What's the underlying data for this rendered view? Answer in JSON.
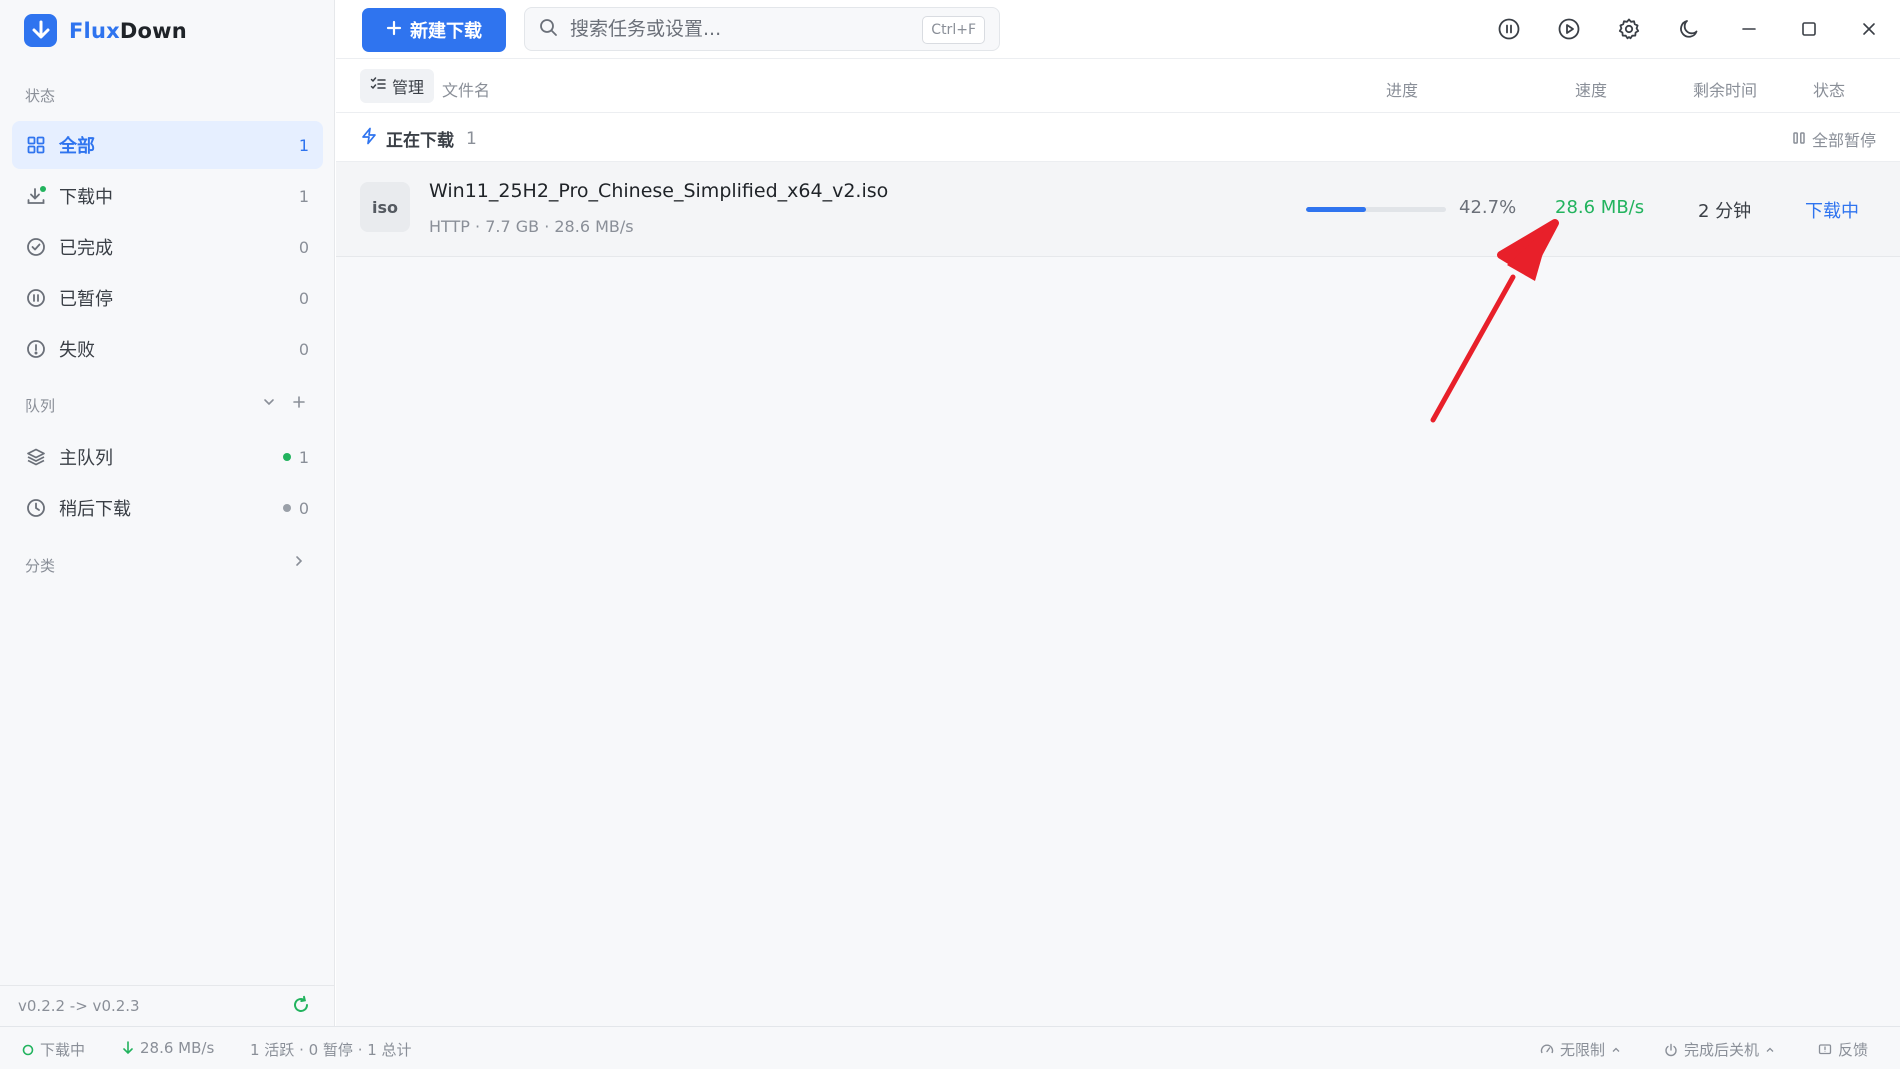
{
  "app": {
    "name_prefix": "Flux",
    "name_suffix": "Down"
  },
  "colors": {
    "accent": "#2f74ef",
    "speed_green": "#22b35e",
    "annotation_red": "#e8202a"
  },
  "toolbar": {
    "new_download_label": "新建下载",
    "search_placeholder": "搜索任务或设置...",
    "search_shortcut": "Ctrl+F",
    "icons": [
      "pause-all-icon",
      "resume-all-icon",
      "settings-gear-icon",
      "dark-mode-moon-icon",
      "minimize-icon",
      "maximize-icon",
      "close-icon"
    ]
  },
  "sidebar": {
    "status_label": "状态",
    "status_items": [
      {
        "label": "全部",
        "count": "1",
        "icon": "grid-icon"
      },
      {
        "label": "下载中",
        "count": "1",
        "icon": "download-icon"
      },
      {
        "label": "已完成",
        "count": "0",
        "icon": "check-circle-icon"
      },
      {
        "label": "已暂停",
        "count": "0",
        "icon": "pause-circle-icon"
      },
      {
        "label": "失败",
        "count": "0",
        "icon": "alert-circle-icon"
      }
    ],
    "queue_label": "队列",
    "queue_items": [
      {
        "label": "主队列",
        "count": "1",
        "dot_color": "#22b35e",
        "icon": "layers-icon"
      },
      {
        "label": "稍后下载",
        "count": "0",
        "dot_color": "#9aa0a8",
        "icon": "clock-icon"
      }
    ],
    "category_label": "分类",
    "version": "v0.2.2 -> v0.2.3"
  },
  "columns": {
    "manage": "管理",
    "filename": "文件名",
    "progress": "进度",
    "speed": "速度",
    "remaining": "剩余时间",
    "status": "状态"
  },
  "group": {
    "title": "正在下载",
    "count": "1",
    "pause_all": "全部暂停"
  },
  "task": {
    "ext": "iso",
    "name": "Win11_25H2_Pro_Chinese_Simplified_x64_v2.iso",
    "meta": "HTTP · 7.7 GB · 28.6 MB/s",
    "progress_percent": 42.7,
    "progress_text": "42.7%",
    "speed": "28.6 MB/s",
    "remaining": "2 分钟",
    "status": "下载中"
  },
  "statusbar": {
    "state": "下载中",
    "speed": "28.6 MB/s",
    "summary": "1 活跃 · 0 暂停 · 1 总计",
    "limit": "无限制",
    "after_complete": "完成后关机",
    "feedback": "反馈"
  }
}
